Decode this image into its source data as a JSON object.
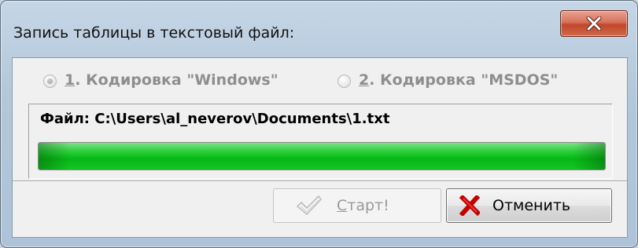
{
  "window": {
    "title": "Запись таблицы в текстовый файл:",
    "close_icon": "close-x-icon"
  },
  "encoding": {
    "option1": {
      "mnemonic": "1",
      "label": ". Кодировка \"Windows\"",
      "checked": true,
      "enabled": false
    },
    "option2": {
      "mnemonic": "2",
      "label": ". Кодировка \"MSDOS\"",
      "checked": false,
      "enabled": false
    }
  },
  "file": {
    "label": "Файл: C:\\Users\\al_neverov\\Documents\\1.txt"
  },
  "progress": {
    "value_percent": 100,
    "color": "#0cbd1c"
  },
  "buttons": {
    "start": {
      "mnemonic": "С",
      "label": "тарт!",
      "enabled": false,
      "icon": "checkmark-icon"
    },
    "cancel": {
      "label": "Отменить",
      "enabled": true,
      "icon": "red-x-icon"
    }
  }
}
